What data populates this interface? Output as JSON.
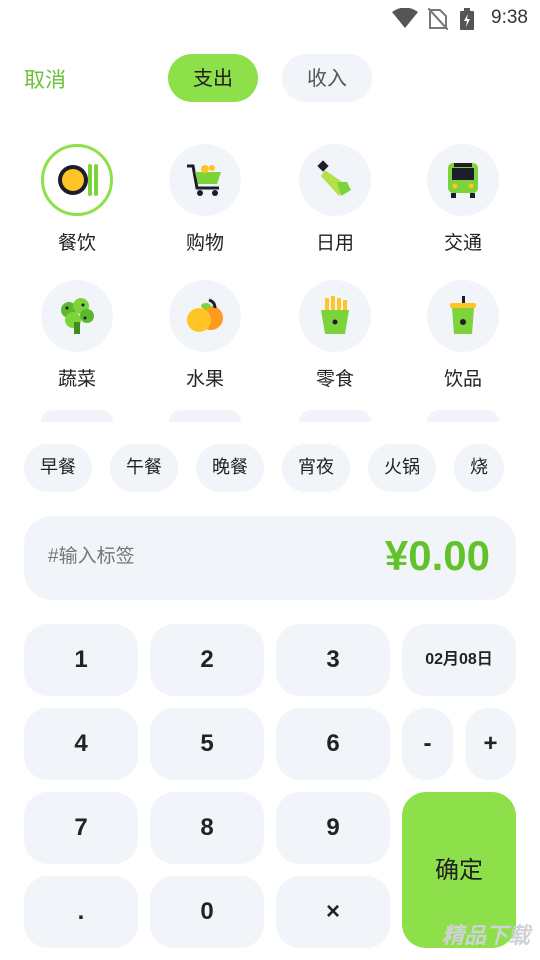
{
  "status_bar": {
    "time": "9:38"
  },
  "header": {
    "cancel": "取消",
    "expense_tab": "支出",
    "income_tab": "收入"
  },
  "categories": [
    {
      "label": "餐饮",
      "icon": "meal-icon",
      "selected": true
    },
    {
      "label": "购物",
      "icon": "shopping-cart-icon",
      "selected": false
    },
    {
      "label": "日用",
      "icon": "toothpaste-icon",
      "selected": false
    },
    {
      "label": "交通",
      "icon": "bus-icon",
      "selected": false
    },
    {
      "label": "蔬菜",
      "icon": "broccoli-icon",
      "selected": false
    },
    {
      "label": "水果",
      "icon": "fruit-icon",
      "selected": false
    },
    {
      "label": "零食",
      "icon": "fries-icon",
      "selected": false
    },
    {
      "label": "饮品",
      "icon": "drink-icon",
      "selected": false
    }
  ],
  "tags": [
    "早餐",
    "午餐",
    "晚餐",
    "宵夜",
    "火锅",
    "烧"
  ],
  "amount_row": {
    "placeholder": "#输入标签",
    "amount": "¥0.00"
  },
  "keypad": {
    "k1": "1",
    "k2": "2",
    "k3": "3",
    "date": "02月08日",
    "k4": "4",
    "k5": "5",
    "k6": "6",
    "minus": "-",
    "plus": "+",
    "k7": "7",
    "k8": "8",
    "k9": "9",
    "dot": ".",
    "k0": "0",
    "backspace": "×",
    "confirm": "确定"
  },
  "watermark": "精品下载",
  "colors": {
    "accent": "#8ee04a",
    "amount": "#62c22a",
    "key_bg": "#f1f4f8"
  }
}
